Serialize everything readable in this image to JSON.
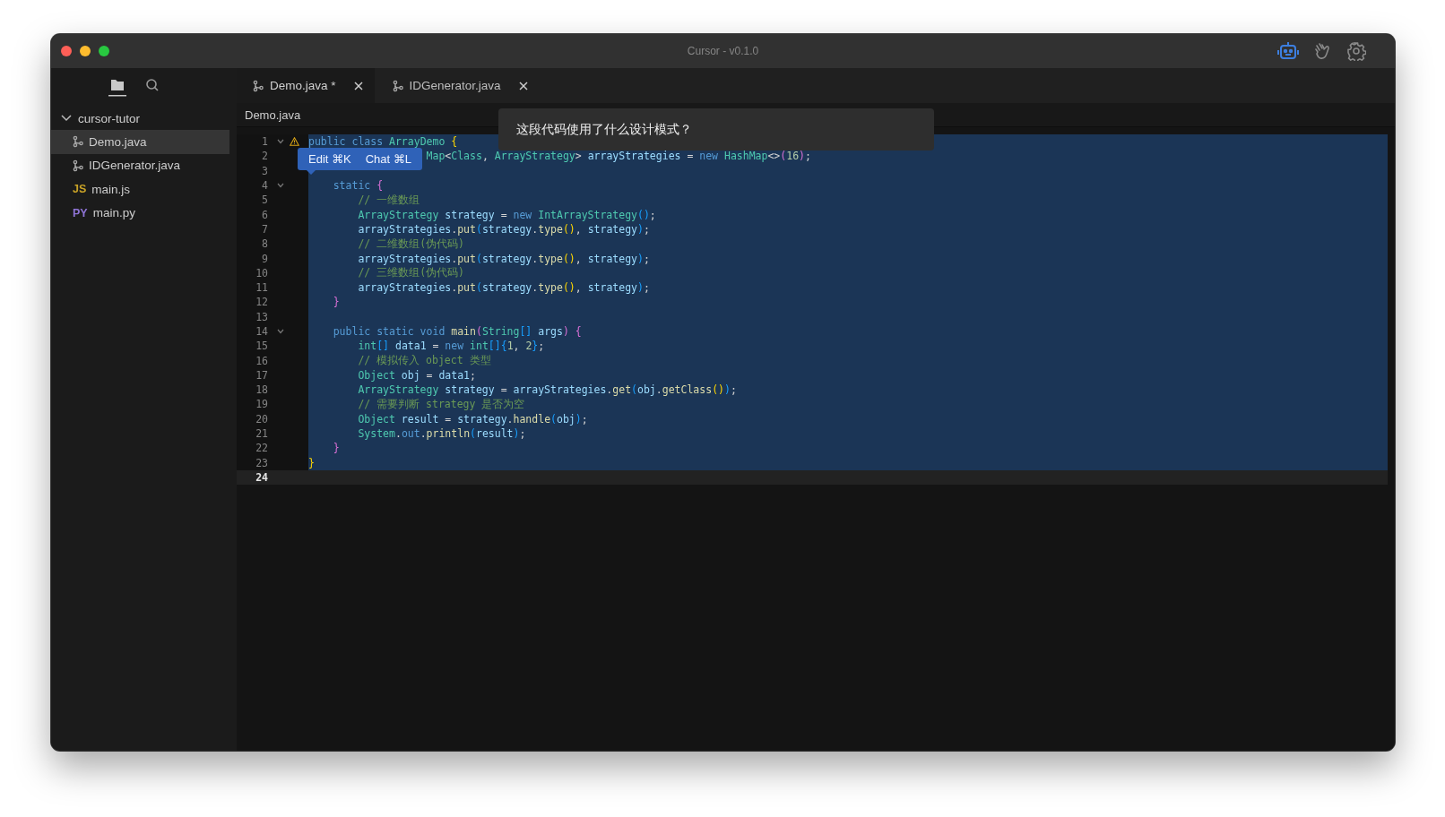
{
  "window": {
    "title": "Cursor - v0.1.0"
  },
  "sidebar": {
    "views": [
      {
        "kind": "files",
        "selected": true
      },
      {
        "kind": "search",
        "selected": false
      }
    ],
    "tree": {
      "label": "cursor-tutor",
      "expanded": true,
      "children": [
        {
          "label": "Demo.java",
          "kind": "branch",
          "selected": true
        },
        {
          "label": "IDGenerator.java",
          "kind": "branch",
          "selected": false
        },
        {
          "label": "main.js",
          "kind": "badge",
          "badge": "JS",
          "color": "#c9a227",
          "selected": false
        },
        {
          "label": "main.py",
          "kind": "badge",
          "badge": "PY",
          "color": "#8f74d6",
          "selected": false
        }
      ]
    }
  },
  "tabs": [
    {
      "label": "Demo.java *",
      "selected": true
    },
    {
      "label": "IDGenerator.java",
      "selected": false
    }
  ],
  "breadcrumb": "Demo.java",
  "chat_prompt": "这段代码使用了什么设计模式？",
  "inline_actions": [
    {
      "label": "Edit ⌘K"
    },
    {
      "label": "Chat ⌘L"
    }
  ],
  "editor": {
    "lines": [
      {
        "number": "1",
        "kind": "full",
        "foldable": true,
        "warning": true,
        "selected": true,
        "current": false,
        "tokens": [
          {
            "text": "public class ",
            "kind": "kw"
          },
          {
            "text": "ArrayDemo",
            "kind": "ty"
          },
          {
            "text": " {",
            "kind": "b1"
          }
        ]
      },
      {
        "number": "2",
        "kind": "covered",
        "foldable": false,
        "warning": false,
        "selected": true,
        "current": false,
        "tokens": [
          {
            "text": "Map",
            "kind": "ty"
          },
          {
            "text": "<",
            "kind": "pu"
          },
          {
            "text": "Class",
            "kind": "ty"
          },
          {
            "text": ", ",
            "kind": "pu"
          },
          {
            "text": "ArrayStrategy",
            "kind": "ty"
          },
          {
            "text": "> ",
            "kind": "pu"
          },
          {
            "text": "arrayStrategies",
            "kind": "va"
          },
          {
            "text": " = ",
            "kind": "pu"
          },
          {
            "text": "new",
            "kind": "kw"
          },
          {
            "text": " HashMap",
            "kind": "ty"
          },
          {
            "text": "<>",
            "kind": "pu"
          },
          {
            "text": "(",
            "kind": "b2"
          },
          {
            "text": "16",
            "kind": "nu"
          },
          {
            "text": ")",
            "kind": "b2"
          },
          {
            "text": ";",
            "kind": "pu"
          }
        ]
      },
      {
        "number": "3",
        "kind": "full",
        "foldable": false,
        "warning": false,
        "selected": true,
        "current": false
      },
      {
        "number": "4",
        "kind": "full",
        "foldable": true,
        "warning": false,
        "selected": true,
        "current": false,
        "tokens": [
          {
            "text": "    static",
            "kind": "kw"
          },
          {
            "text": " {",
            "kind": "b2"
          }
        ]
      },
      {
        "number": "5",
        "kind": "full",
        "foldable": false,
        "warning": false,
        "selected": true,
        "current": false,
        "tokens": [
          {
            "text": "        // 一维数组",
            "kind": "cm"
          }
        ]
      },
      {
        "number": "6",
        "kind": "full",
        "foldable": false,
        "warning": false,
        "selected": true,
        "current": false,
        "tokens": [
          {
            "text": "        ArrayStrategy",
            "kind": "ty"
          },
          {
            "text": " strategy",
            "kind": "va"
          },
          {
            "text": " = ",
            "kind": "pu"
          },
          {
            "text": "new",
            "kind": "kw"
          },
          {
            "text": " IntArrayStrategy",
            "kind": "ty"
          },
          {
            "text": "()",
            "kind": "b3"
          },
          {
            "text": ";",
            "kind": "pu"
          }
        ]
      },
      {
        "number": "7",
        "kind": "full",
        "foldable": false,
        "warning": false,
        "selected": true,
        "current": false,
        "tokens": [
          {
            "text": "        arrayStrategies",
            "kind": "va"
          },
          {
            "text": ".",
            "kind": "pu"
          },
          {
            "text": "put",
            "kind": "fn"
          },
          {
            "text": "(",
            "kind": "b3"
          },
          {
            "text": "strategy",
            "kind": "va"
          },
          {
            "text": ".",
            "kind": "pu"
          },
          {
            "text": "type",
            "kind": "fn"
          },
          {
            "text": "()",
            "kind": "b1"
          },
          {
            "text": ", ",
            "kind": "pu"
          },
          {
            "text": "strategy",
            "kind": "va"
          },
          {
            "text": ")",
            "kind": "b3"
          },
          {
            "text": ";",
            "kind": "pu"
          }
        ]
      },
      {
        "number": "8",
        "kind": "full",
        "foldable": false,
        "warning": false,
        "selected": true,
        "current": false,
        "tokens": [
          {
            "text": "        // 二维数组(伪代码)",
            "kind": "cm"
          }
        ]
      },
      {
        "number": "9",
        "kind": "full",
        "foldable": false,
        "warning": false,
        "selected": true,
        "current": false,
        "tokens": [
          {
            "text": "        arrayStrategies",
            "kind": "va"
          },
          {
            "text": ".",
            "kind": "pu"
          },
          {
            "text": "put",
            "kind": "fn"
          },
          {
            "text": "(",
            "kind": "b3"
          },
          {
            "text": "strategy",
            "kind": "va"
          },
          {
            "text": ".",
            "kind": "pu"
          },
          {
            "text": "type",
            "kind": "fn"
          },
          {
            "text": "()",
            "kind": "b1"
          },
          {
            "text": ", ",
            "kind": "pu"
          },
          {
            "text": "strategy",
            "kind": "va"
          },
          {
            "text": ")",
            "kind": "b3"
          },
          {
            "text": ";",
            "kind": "pu"
          }
        ]
      },
      {
        "number": "10",
        "kind": "full",
        "foldable": false,
        "warning": false,
        "selected": true,
        "current": false,
        "tokens": [
          {
            "text": "        // 三维数组(伪代码)",
            "kind": "cm"
          }
        ]
      },
      {
        "number": "11",
        "kind": "full",
        "foldable": false,
        "warning": false,
        "selected": true,
        "current": false,
        "tokens": [
          {
            "text": "        arrayStrategies",
            "kind": "va"
          },
          {
            "text": ".",
            "kind": "pu"
          },
          {
            "text": "put",
            "kind": "fn"
          },
          {
            "text": "(",
            "kind": "b3"
          },
          {
            "text": "strategy",
            "kind": "va"
          },
          {
            "text": ".",
            "kind": "pu"
          },
          {
            "text": "type",
            "kind": "fn"
          },
          {
            "text": "()",
            "kind": "b1"
          },
          {
            "text": ", ",
            "kind": "pu"
          },
          {
            "text": "strategy",
            "kind": "va"
          },
          {
            "text": ")",
            "kind": "b3"
          },
          {
            "text": ";",
            "kind": "pu"
          }
        ]
      },
      {
        "number": "12",
        "kind": "full",
        "foldable": false,
        "warning": false,
        "selected": true,
        "current": false,
        "tokens": [
          {
            "text": "    }",
            "kind": "b2"
          }
        ]
      },
      {
        "number": "13",
        "kind": "full",
        "foldable": false,
        "warning": false,
        "selected": true,
        "current": false
      },
      {
        "number": "14",
        "kind": "full",
        "foldable": true,
        "warning": false,
        "selected": true,
        "current": false,
        "tokens": [
          {
            "text": "    public static void",
            "kind": "kw"
          },
          {
            "text": " main",
            "kind": "fn"
          },
          {
            "text": "(",
            "kind": "b2"
          },
          {
            "text": "String",
            "kind": "ty"
          },
          {
            "text": "[]",
            "kind": "b3"
          },
          {
            "text": " args",
            "kind": "va"
          },
          {
            "text": ")",
            "kind": "b2"
          },
          {
            "text": " {",
            "kind": "b2"
          }
        ]
      },
      {
        "number": "15",
        "kind": "full",
        "foldable": false,
        "warning": false,
        "selected": true,
        "current": false,
        "tokens": [
          {
            "text": "        int",
            "kind": "ty"
          },
          {
            "text": "[]",
            "kind": "b3"
          },
          {
            "text": " data1",
            "kind": "va"
          },
          {
            "text": " = ",
            "kind": "pu"
          },
          {
            "text": "new",
            "kind": "kw"
          },
          {
            "text": " int",
            "kind": "ty"
          },
          {
            "text": "[]{",
            "kind": "b3"
          },
          {
            "text": "1",
            "kind": "nu"
          },
          {
            "text": ", ",
            "kind": "pu"
          },
          {
            "text": "2",
            "kind": "nu"
          },
          {
            "text": "}",
            "kind": "b3"
          },
          {
            "text": ";",
            "kind": "pu"
          }
        ]
      },
      {
        "number": "16",
        "kind": "full",
        "foldable": false,
        "warning": false,
        "selected": true,
        "current": false,
        "tokens": [
          {
            "text": "        // 模拟传入 object 类型",
            "kind": "cm"
          }
        ]
      },
      {
        "number": "17",
        "kind": "full",
        "foldable": false,
        "warning": false,
        "selected": true,
        "current": false,
        "tokens": [
          {
            "text": "        Object",
            "kind": "ty"
          },
          {
            "text": " obj",
            "kind": "va"
          },
          {
            "text": " = ",
            "kind": "pu"
          },
          {
            "text": "data1",
            "kind": "va"
          },
          {
            "text": ";",
            "kind": "pu"
          }
        ]
      },
      {
        "number": "18",
        "kind": "full",
        "foldable": false,
        "warning": false,
        "selected": true,
        "current": false,
        "tokens": [
          {
            "text": "        ArrayStrategy",
            "kind": "ty"
          },
          {
            "text": " strategy",
            "kind": "va"
          },
          {
            "text": " = ",
            "kind": "pu"
          },
          {
            "text": "arrayStrategies",
            "kind": "va"
          },
          {
            "text": ".",
            "kind": "pu"
          },
          {
            "text": "get",
            "kind": "fn"
          },
          {
            "text": "(",
            "kind": "b3"
          },
          {
            "text": "obj",
            "kind": "va"
          },
          {
            "text": ".",
            "kind": "pu"
          },
          {
            "text": "getClass",
            "kind": "fn"
          },
          {
            "text": "()",
            "kind": "b1"
          },
          {
            "text": ")",
            "kind": "b3"
          },
          {
            "text": ";",
            "kind": "pu"
          }
        ]
      },
      {
        "number": "19",
        "kind": "full",
        "foldable": false,
        "warning": false,
        "selected": true,
        "current": false,
        "tokens": [
          {
            "text": "        // 需要判断 strategy 是否为空",
            "kind": "cm"
          }
        ]
      },
      {
        "number": "20",
        "kind": "full",
        "foldable": false,
        "warning": false,
        "selected": true,
        "current": false,
        "tokens": [
          {
            "text": "        Object",
            "kind": "ty"
          },
          {
            "text": " result",
            "kind": "va"
          },
          {
            "text": " = ",
            "kind": "pu"
          },
          {
            "text": "strategy",
            "kind": "va"
          },
          {
            "text": ".",
            "kind": "pu"
          },
          {
            "text": "handle",
            "kind": "fn"
          },
          {
            "text": "(",
            "kind": "b3"
          },
          {
            "text": "obj",
            "kind": "va"
          },
          {
            "text": ")",
            "kind": "b3"
          },
          {
            "text": ";",
            "kind": "pu"
          }
        ]
      },
      {
        "number": "21",
        "kind": "full",
        "foldable": false,
        "warning": false,
        "selected": true,
        "current": false,
        "tokens": [
          {
            "text": "        System",
            "kind": "ty"
          },
          {
            "text": ".",
            "kind": "pu"
          },
          {
            "text": "out",
            "kind": "kw"
          },
          {
            "text": ".",
            "kind": "pu"
          },
          {
            "text": "println",
            "kind": "fn"
          },
          {
            "text": "(",
            "kind": "b3"
          },
          {
            "text": "result",
            "kind": "va"
          },
          {
            "text": ")",
            "kind": "b3"
          },
          {
            "text": ";",
            "kind": "pu"
          }
        ]
      },
      {
        "number": "22",
        "kind": "full",
        "foldable": false,
        "warning": false,
        "selected": true,
        "current": false,
        "tokens": [
          {
            "text": "    }",
            "kind": "b2"
          }
        ]
      },
      {
        "number": "23",
        "kind": "full",
        "foldable": false,
        "warning": false,
        "selected": true,
        "current": false,
        "tokens": [
          {
            "text": "}",
            "kind": "b1"
          }
        ]
      },
      {
        "number": "24",
        "kind": "full",
        "foldable": false,
        "warning": false,
        "selected": false,
        "current": true
      }
    ]
  }
}
